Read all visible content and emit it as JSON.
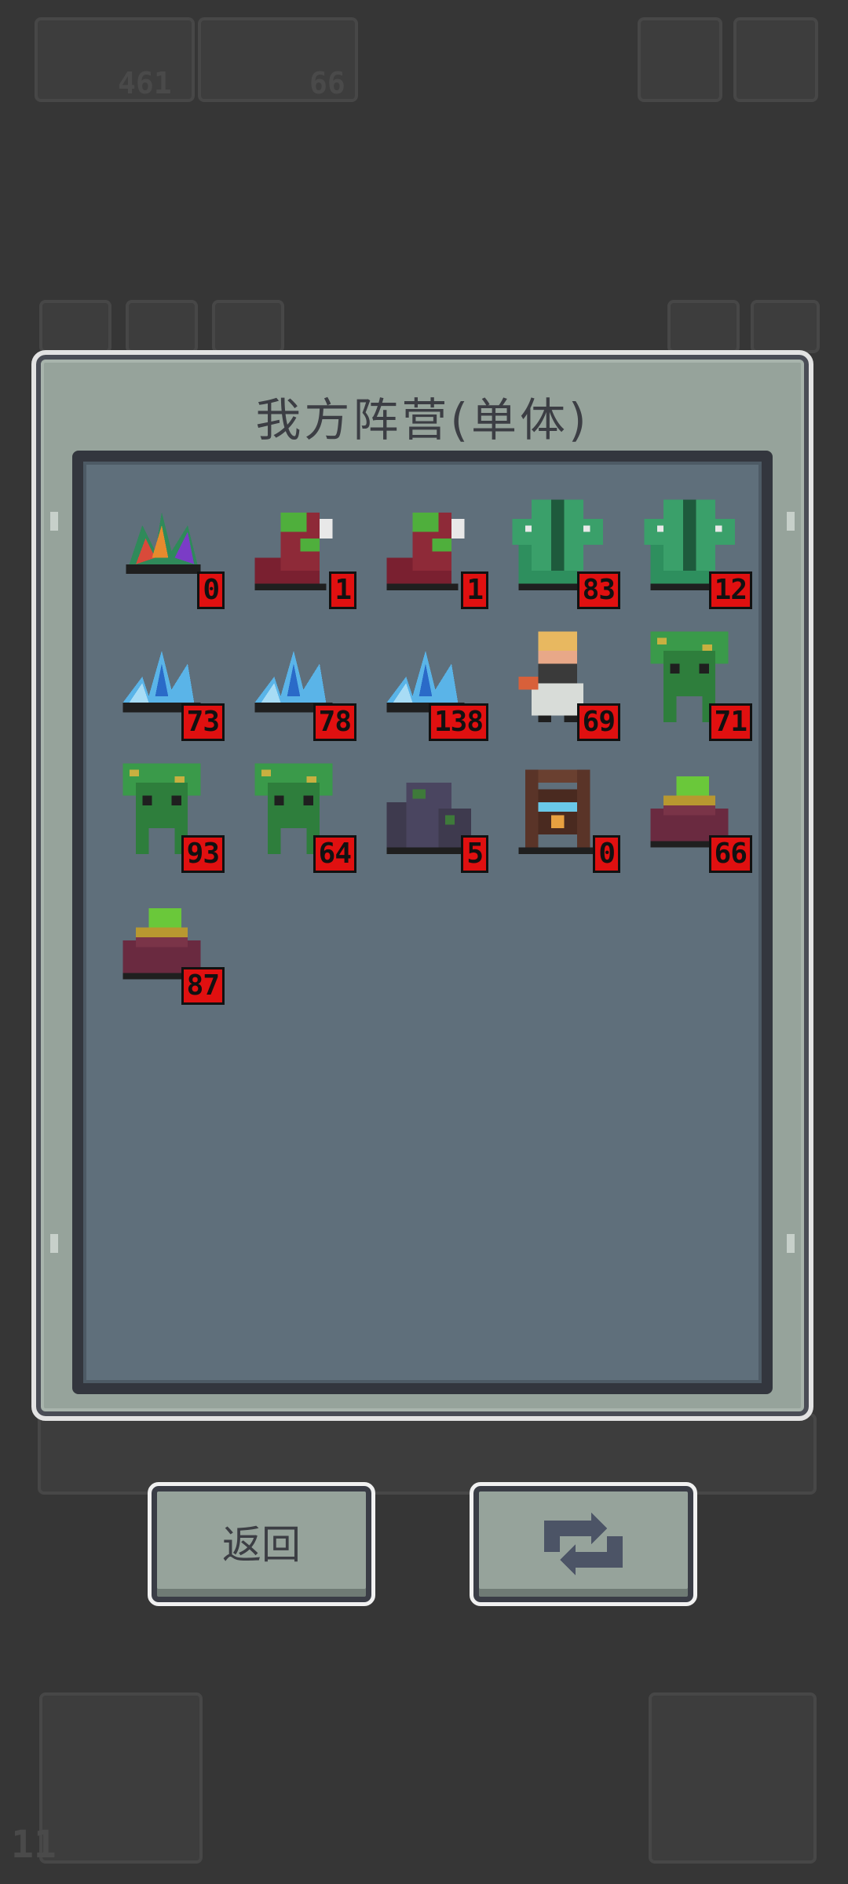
{
  "panel": {
    "title": "我方阵营(单体)"
  },
  "units": [
    {
      "icon": "crystal-plant-icon",
      "count": "0"
    },
    {
      "icon": "red-worm-icon",
      "count": "1"
    },
    {
      "icon": "red-worm-icon",
      "count": "1"
    },
    {
      "icon": "green-golem-icon",
      "count": "83"
    },
    {
      "icon": "green-golem-icon",
      "count": "12"
    },
    {
      "icon": "ice-crystal-icon",
      "count": "73"
    },
    {
      "icon": "ice-crystal-icon",
      "count": "78"
    },
    {
      "icon": "ice-crystal-icon",
      "count": "138"
    },
    {
      "icon": "bearded-warrior-icon",
      "count": "69"
    },
    {
      "icon": "treant-icon",
      "count": "71"
    },
    {
      "icon": "treant-icon",
      "count": "93"
    },
    {
      "icon": "treant-icon",
      "count": "64"
    },
    {
      "icon": "rock-pile-icon",
      "count": "5"
    },
    {
      "icon": "wooden-totem-icon",
      "count": "0"
    },
    {
      "icon": "slime-mound-icon",
      "count": "66"
    },
    {
      "icon": "slime-mound-icon",
      "count": "87"
    }
  ],
  "buttons": {
    "back_label": "返回",
    "refresh_icon": "refresh-icon"
  },
  "background": {
    "num_a": "461",
    "num_b": "66",
    "level": "11"
  }
}
